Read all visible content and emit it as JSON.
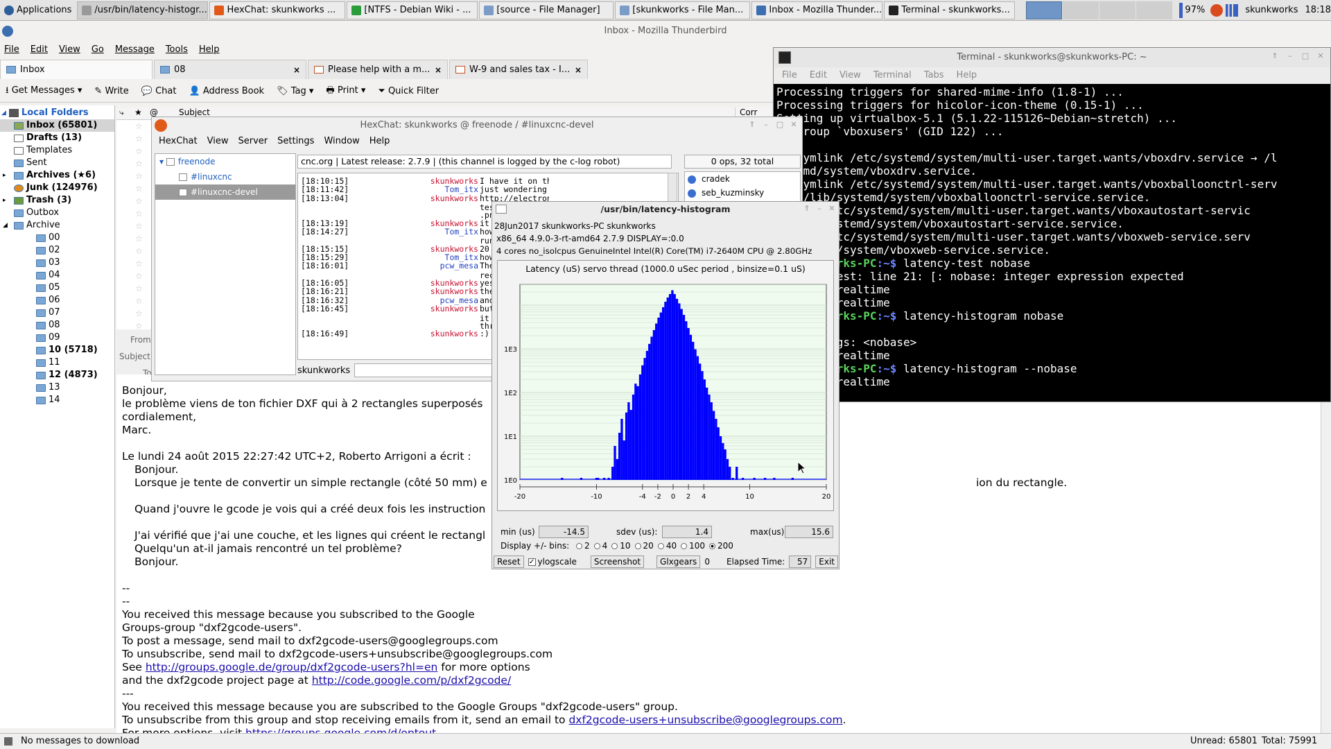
{
  "taskbar": {
    "apps_label": "Applications",
    "windows": [
      {
        "label": "/usr/bin/latency-histogr...",
        "active": true
      },
      {
        "label": "HexChat: skunkworks ..."
      },
      {
        "label": "[NTFS - Debian Wiki - ..."
      },
      {
        "label": "[source - File Manager]"
      },
      {
        "label": "[skunkworks - File Man..."
      },
      {
        "label": "Inbox - Mozilla Thunder..."
      },
      {
        "label": "Terminal - skunkworks..."
      }
    ],
    "battery": "97%",
    "user": "skunkworks",
    "clock": "18:18"
  },
  "thunderbird": {
    "title": "Inbox - Mozilla Thunderbird",
    "menu": [
      "File",
      "Edit",
      "View",
      "Go",
      "Message",
      "Tools",
      "Help"
    ],
    "tabs": [
      {
        "label": "Inbox",
        "selected": true
      },
      {
        "label": "08"
      },
      {
        "label": "Please help with a m..."
      },
      {
        "label": "W-9 and sales tax - I..."
      }
    ],
    "toolbar": {
      "get_messages": "Get Messages",
      "write": "Write",
      "chat": "Chat",
      "address_book": "Address Book",
      "tag": "Tag",
      "print": "Print",
      "quick_filter": "Quick Filter"
    },
    "col_subject": "Subject",
    "col_corr": "Corr",
    "header_from": "From",
    "header_subject": "Subject",
    "header_to": "To",
    "folders": {
      "local": "Local Folders",
      "items": [
        {
          "label": "Inbox (65801)",
          "bold": true,
          "selected": true,
          "indent": 1
        },
        {
          "label": "Drafts (13)",
          "bold": true,
          "indent": 1
        },
        {
          "label": "Templates",
          "indent": 1
        },
        {
          "label": "Sent",
          "indent": 1
        },
        {
          "label": "Archives (★6)",
          "bold": true,
          "indent": 1,
          "twisty": true
        },
        {
          "label": "Junk (124976)",
          "bold": true,
          "indent": 1
        },
        {
          "label": "Trash (3)",
          "bold": true,
          "indent": 1,
          "twisty": true
        },
        {
          "label": "Outbox",
          "indent": 1
        },
        {
          "label": "Archive",
          "indent": 1,
          "twisty": true,
          "open": true
        },
        {
          "label": "00",
          "indent": 2
        },
        {
          "label": "02",
          "indent": 2
        },
        {
          "label": "03",
          "indent": 2
        },
        {
          "label": "04",
          "indent": 2
        },
        {
          "label": "05",
          "indent": 2
        },
        {
          "label": "06",
          "indent": 2
        },
        {
          "label": "07",
          "indent": 2
        },
        {
          "label": "08",
          "indent": 2
        },
        {
          "label": "09",
          "indent": 2
        },
        {
          "label": "10 (5718)",
          "bold": true,
          "indent": 2
        },
        {
          "label": "11",
          "indent": 2
        },
        {
          "label": "12 (4873)",
          "bold": true,
          "indent": 2
        },
        {
          "label": "13",
          "indent": 2
        },
        {
          "label": "14",
          "indent": 2
        }
      ]
    },
    "body_lines": [
      {
        "t": "Bonjour,"
      },
      {
        "t": "le problème viens de ton fichier DXF qui à 2 rectangles superposés"
      },
      {
        "t": "cordialement,"
      },
      {
        "t": "Marc."
      },
      {
        "t": ""
      },
      {
        "t": "Le lundi 24 août 2015 22:27:42 UTC+2, Roberto Arrigoni a écrit :"
      },
      {
        "t": "Bonjour.",
        "q": true
      },
      {
        "t": "Lorsque je tente de convertir un simple rectangle (côté 50 mm) e",
        "q": true,
        "tail": "ion du rectangle."
      },
      {
        "t": "",
        "q": true
      },
      {
        "t": "Quand j'ouvre le gcode je vois qui a créé deux fois les instruction",
        "q": true
      },
      {
        "t": "",
        "q": true
      },
      {
        "t": "J'ai vérifié que j'ai une couche, et les lignes qui créent le rectangl",
        "q": true
      },
      {
        "t": "Quelqu'un at-il jamais rencontré un tel problème?",
        "q": true
      },
      {
        "t": "Bonjour.",
        "q": true
      },
      {
        "t": ""
      },
      {
        "t": "--"
      },
      {
        "t": "--"
      },
      {
        "t": "You received this message because you subscribed to the Google"
      },
      {
        "t": "Groups-group \"dxf2gcode-users\"."
      },
      {
        "t": "To post a message, send mail to dxf2gcode-users@googlegroups.com"
      },
      {
        "t": "To unsubscribe, send mail to dxf2gcode-users+unsubscribe@googlegroups.com"
      }
    ],
    "body_see_pre": "See ",
    "body_see_link": "http://groups.google.de/group/dxf2gcode-users?hl=en",
    "body_see_post": " for more options",
    "body_proj_pre": "and the dxf2gcode project page at ",
    "body_proj_link": "http://code.google.com/p/dxf2gcode/",
    "body_sep": "---",
    "body_recv": "You received this message because you are subscribed to the Google Groups \"dxf2gcode-users\" group.",
    "body_unsub_pre": "To unsubscribe from this group and stop receiving emails from it, send an email to ",
    "body_unsub_link": "dxf2gcode-users+unsubscribe@googlegroups.com",
    "body_unsub_post": ".",
    "body_more_pre": "For more options, visit ",
    "body_more_link": "https://groups.google.com/d/optout",
    "body_more_post": ".",
    "status": "No messages to download",
    "unread": "Unread: 65801",
    "total": "Total: 75991"
  },
  "terminal": {
    "title": "Terminal - skunkworks@skunkworks-PC: ~",
    "menu": [
      "File",
      "Edit",
      "View",
      "Terminal",
      "Tabs",
      "Help"
    ],
    "prompt_user": "s@skunkworks-PC",
    "prompt_path": ":~$",
    "lines": [
      {
        "t": "Processing triggers for shared-mime-info (1.8-1) ..."
      },
      {
        "t": "Processing triggers for hicolor-icon-theme (0.15-1) ..."
      },
      {
        "t": "Setting up virtualbox-5.1 (5.1.22-115126~Debian~stretch) ..."
      },
      {
        "t": "ng group `vboxusers' (GID 122) ..."
      },
      {
        "t": ""
      },
      {
        "t": "ed symlink /etc/systemd/system/multi-user.target.wants/vboxdrv.service → /l"
      },
      {
        "t": "ystemd/system/vboxdrv.service."
      },
      {
        "t": "ed symlink /etc/systemd/system/multi-user.target.wants/vboxballoonctrl-serv"
      },
      {
        "t": "e → /lib/systemd/system/vboxballoonctrl-service.service."
      },
      {
        "t": "ymlink /etc/systemd/system/multi-user.target.wants/vboxautostart-servic"
      },
      {
        "t": "→ /lib/systemd/system/vboxautostart-service.service."
      },
      {
        "t": "ymlink /etc/systemd/system/multi-user.target.wants/vboxweb-service.serv"
      },
      {
        "t": "b/systemd/system/vboxweb-service.service."
      },
      {
        "t": " latency-test nobase",
        "prompt": true
      },
      {
        "t": "latency-test: line 21: [: nobase: integer expression expected"
      },
      {
        "t": "ng POSIX realtime"
      },
      {
        "t": "ng POSIX realtime"
      },
      {
        "t": " latency-histogram nobase",
        "prompt": true
      },
      {
        "t": ""
      },
      {
        "t": "nknown args: <nobase>"
      },
      {
        "t": "ng POSIX realtime"
      },
      {
        "t": " latency-histogram --nobase",
        "prompt": true
      },
      {
        "t": "ng POSIX realtime"
      }
    ]
  },
  "hexchat": {
    "title": "HexChat: skunkworks @ freenode / #linuxcnc-devel",
    "menu": [
      "HexChat",
      "View",
      "Server",
      "Settings",
      "Window",
      "Help"
    ],
    "tree": [
      {
        "label": "freenode",
        "level": 0
      },
      {
        "label": "#linuxcnc",
        "level": 1
      },
      {
        "label": "#linuxcnc-devel",
        "level": 1,
        "selected": true
      }
    ],
    "topic": "cnc.org | Latest release: 2.7.9 | (this channel is logged by the c-log robot)",
    "ops": "0 ops, 32 total",
    "users": [
      "cradek",
      "seb_kuzminsky"
    ],
    "nick": "skunkworks",
    "chat": [
      {
        "t": "[18:10:15]",
        "n": "skunkworks",
        "m": "I have it on this laptop - yes"
      },
      {
        "t": "[18:11:42]",
        "n": "Tom_itx",
        "m": "just wondering what hardware it was"
      },
      {
        "t": "[18:13:04]",
        "n": "skunkworks",
        "m": "http://electronicsam.com/images/KandT/"
      },
      {
        "t": "",
        "n": "",
        "m": "tes"
      },
      {
        "t": "",
        "n": "",
        "m": ".pn"
      },
      {
        "t": "[18:13:19]",
        "n": "skunkworks",
        "m": "it"
      },
      {
        "t": "[18:14:27]",
        "n": "Tom_itx",
        "m": "how"
      },
      {
        "t": "",
        "n": "",
        "m": "run"
      },
      {
        "t": "[18:15:15]",
        "n": "skunkworks",
        "m": "20"
      },
      {
        "t": "[18:15:29]",
        "n": "Tom_itx",
        "m": "how"
      },
      {
        "t": "[18:16:01]",
        "n": "pcw_mesa",
        "m": "The"
      },
      {
        "t": "",
        "n": "",
        "m": "rec"
      },
      {
        "t": "[18:16:05]",
        "n": "skunkworks",
        "m": "yes"
      },
      {
        "t": "[18:16:21]",
        "n": "skunkworks",
        "m": "the"
      },
      {
        "t": "[18:16:32]",
        "n": "pcw_mesa",
        "m": "and"
      },
      {
        "t": "[18:16:45]",
        "n": "skunkworks",
        "m": "but"
      },
      {
        "t": "",
        "n": "",
        "m": "it"
      },
      {
        "t": "",
        "n": "",
        "m": "thr"
      },
      {
        "t": "[18:16:49]",
        "n": "skunkworks",
        "m": ":)"
      }
    ]
  },
  "latency": {
    "title": "/usr/bin/latency-histogram",
    "info1": "28Jun2017 skunkworks-PC skunkworks",
    "info2": "x86_64  4.9.0-3-rt-amd64  2.7.9  DISPLAY=:0.0",
    "info3": "4 cores  no_isolcpus   GenuineIntel  Intel(R) Core(TM) i7-2640M CPU @ 2.80GHz",
    "min_label": "min (us)",
    "min_value": "-14.5",
    "sdev_label": "sdev (us):",
    "sdev_value": "1.4",
    "max_label": "max(us)",
    "max_value": "15.6",
    "bins_label": "Display +/- bins:",
    "bins": [
      {
        "v": "2"
      },
      {
        "v": "4"
      },
      {
        "v": "10"
      },
      {
        "v": "20"
      },
      {
        "v": "40"
      },
      {
        "v": "100"
      },
      {
        "v": "200",
        "on": true
      }
    ],
    "reset": "Reset",
    "ylogscale": "ylogscale",
    "screenshot": "Screenshot",
    "glxgears": "Glxgears",
    "glxgears_value": "0",
    "elapsed_label": "Elapsed Time:",
    "elapsed_value": "57",
    "exit": "Exit"
  },
  "chart_data": {
    "type": "bar",
    "title": "Latency (uS) servo thread (1000.0 uSec period , binsize=0.1 uS)",
    "xlabel": "",
    "ylabel": "",
    "xlim": [
      -20,
      20
    ],
    "yscale": "log",
    "ylim": [
      1,
      30000
    ],
    "xticks": [
      -20,
      -10,
      -4,
      -2,
      0,
      2,
      4,
      10,
      20
    ],
    "yticks": [
      "1E0",
      "1E1",
      "1E2",
      "1E3"
    ],
    "grid": true,
    "color": "#0000ff",
    "x": [
      -14.5,
      -12.0,
      -10.0,
      -9.8,
      -9.0,
      -8.4,
      -7.9,
      -7.6,
      -7.3,
      -7.0,
      -6.7,
      -6.4,
      -6.1,
      -5.8,
      -5.5,
      -5.2,
      -4.9,
      -4.6,
      -4.3,
      -4.0,
      -3.7,
      -3.4,
      -3.1,
      -2.8,
      -2.5,
      -2.2,
      -1.9,
      -1.6,
      -1.3,
      -1.0,
      -0.7,
      -0.4,
      -0.1,
      0.2,
      0.5,
      0.8,
      1.1,
      1.4,
      1.7,
      2.0,
      2.3,
      2.6,
      2.9,
      3.2,
      3.5,
      3.8,
      4.1,
      4.4,
      4.7,
      5.0,
      5.3,
      5.6,
      5.9,
      6.2,
      6.5,
      6.8,
      7.1,
      7.4,
      7.8,
      8.3,
      9.1,
      10.6,
      12.0,
      13.2,
      15.6
    ],
    "values": [
      1,
      1,
      1,
      1,
      1,
      1,
      2,
      6,
      3,
      12,
      25,
      8,
      35,
      60,
      40,
      90,
      160,
      140,
      260,
      420,
      620,
      900,
      1300,
      1900,
      2700,
      3800,
      5200,
      6800,
      9000,
      12000,
      15000,
      18000,
      22000,
      18000,
      14000,
      11000,
      8200,
      6000,
      4300,
      3000,
      2100,
      1450,
      980,
      680,
      460,
      310,
      200,
      130,
      90,
      60,
      38,
      25,
      16,
      10,
      7,
      5,
      3,
      2,
      1,
      2,
      1,
      1,
      1,
      1,
      1
    ]
  }
}
